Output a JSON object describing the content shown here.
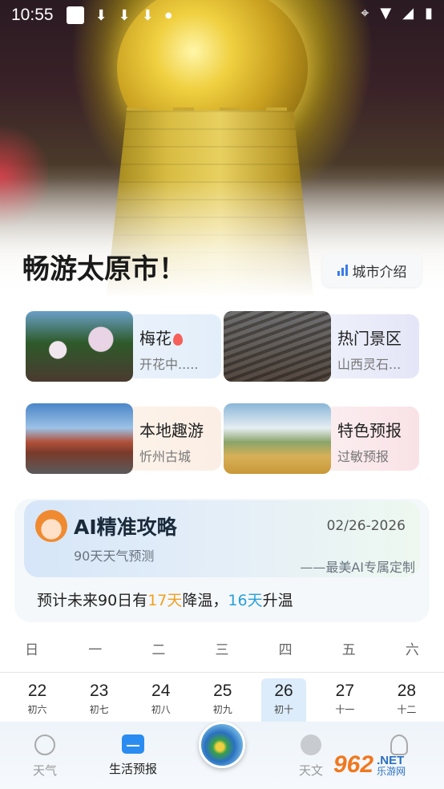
{
  "status_bar": {
    "time": "10:55",
    "icons": [
      "app-icon",
      "download-icon",
      "download-icon",
      "download-icon",
      "dot",
      "location-icon",
      "wifi-icon",
      "signal-icon",
      "battery-icon"
    ]
  },
  "hero": {
    "title": "畅游太原市！",
    "city_intro_label": "城市介绍"
  },
  "cards": [
    {
      "title": "梅花",
      "subtitle": "开花中.....",
      "hot": true
    },
    {
      "title": "热门景区",
      "subtitle": "山西灵石..."
    },
    {
      "title": "本地趣游",
      "subtitle": "忻州古城"
    },
    {
      "title": "特色预报",
      "subtitle": "过敏预报"
    }
  ],
  "ai_panel": {
    "title": "AI精准攻略",
    "date": "02/26-2026",
    "subtitle": "90天天气预测",
    "slogan": "——最美AI专属定制",
    "forecast_prefix": "预计未来90日有",
    "cool_days": "17天",
    "cool_label": "降温，",
    "warm_days": "16天",
    "warm_label": "升温"
  },
  "calendar": {
    "weekdays": [
      "日",
      "一",
      "二",
      "三",
      "四",
      "五",
      "六"
    ],
    "days": [
      {
        "num": "22",
        "lunar": "初六"
      },
      {
        "num": "23",
        "lunar": "初七"
      },
      {
        "num": "24",
        "lunar": "初八"
      },
      {
        "num": "25",
        "lunar": "初九"
      },
      {
        "num": "26",
        "lunar": "初十",
        "selected": true
      },
      {
        "num": "27",
        "lunar": "十一"
      },
      {
        "num": "28",
        "lunar": "十二"
      }
    ]
  },
  "bottom_nav": {
    "items": [
      {
        "label": "天气",
        "icon": "sun-icon"
      },
      {
        "label": "生活预报",
        "icon": "folder-icon",
        "active": true
      },
      {
        "label": "天文",
        "icon": "planet-icon"
      },
      {
        "label": "",
        "icon": "person-icon"
      }
    ]
  },
  "watermark": {
    "logo": "962",
    "domain": ".NET",
    "text": "乐游网"
  }
}
